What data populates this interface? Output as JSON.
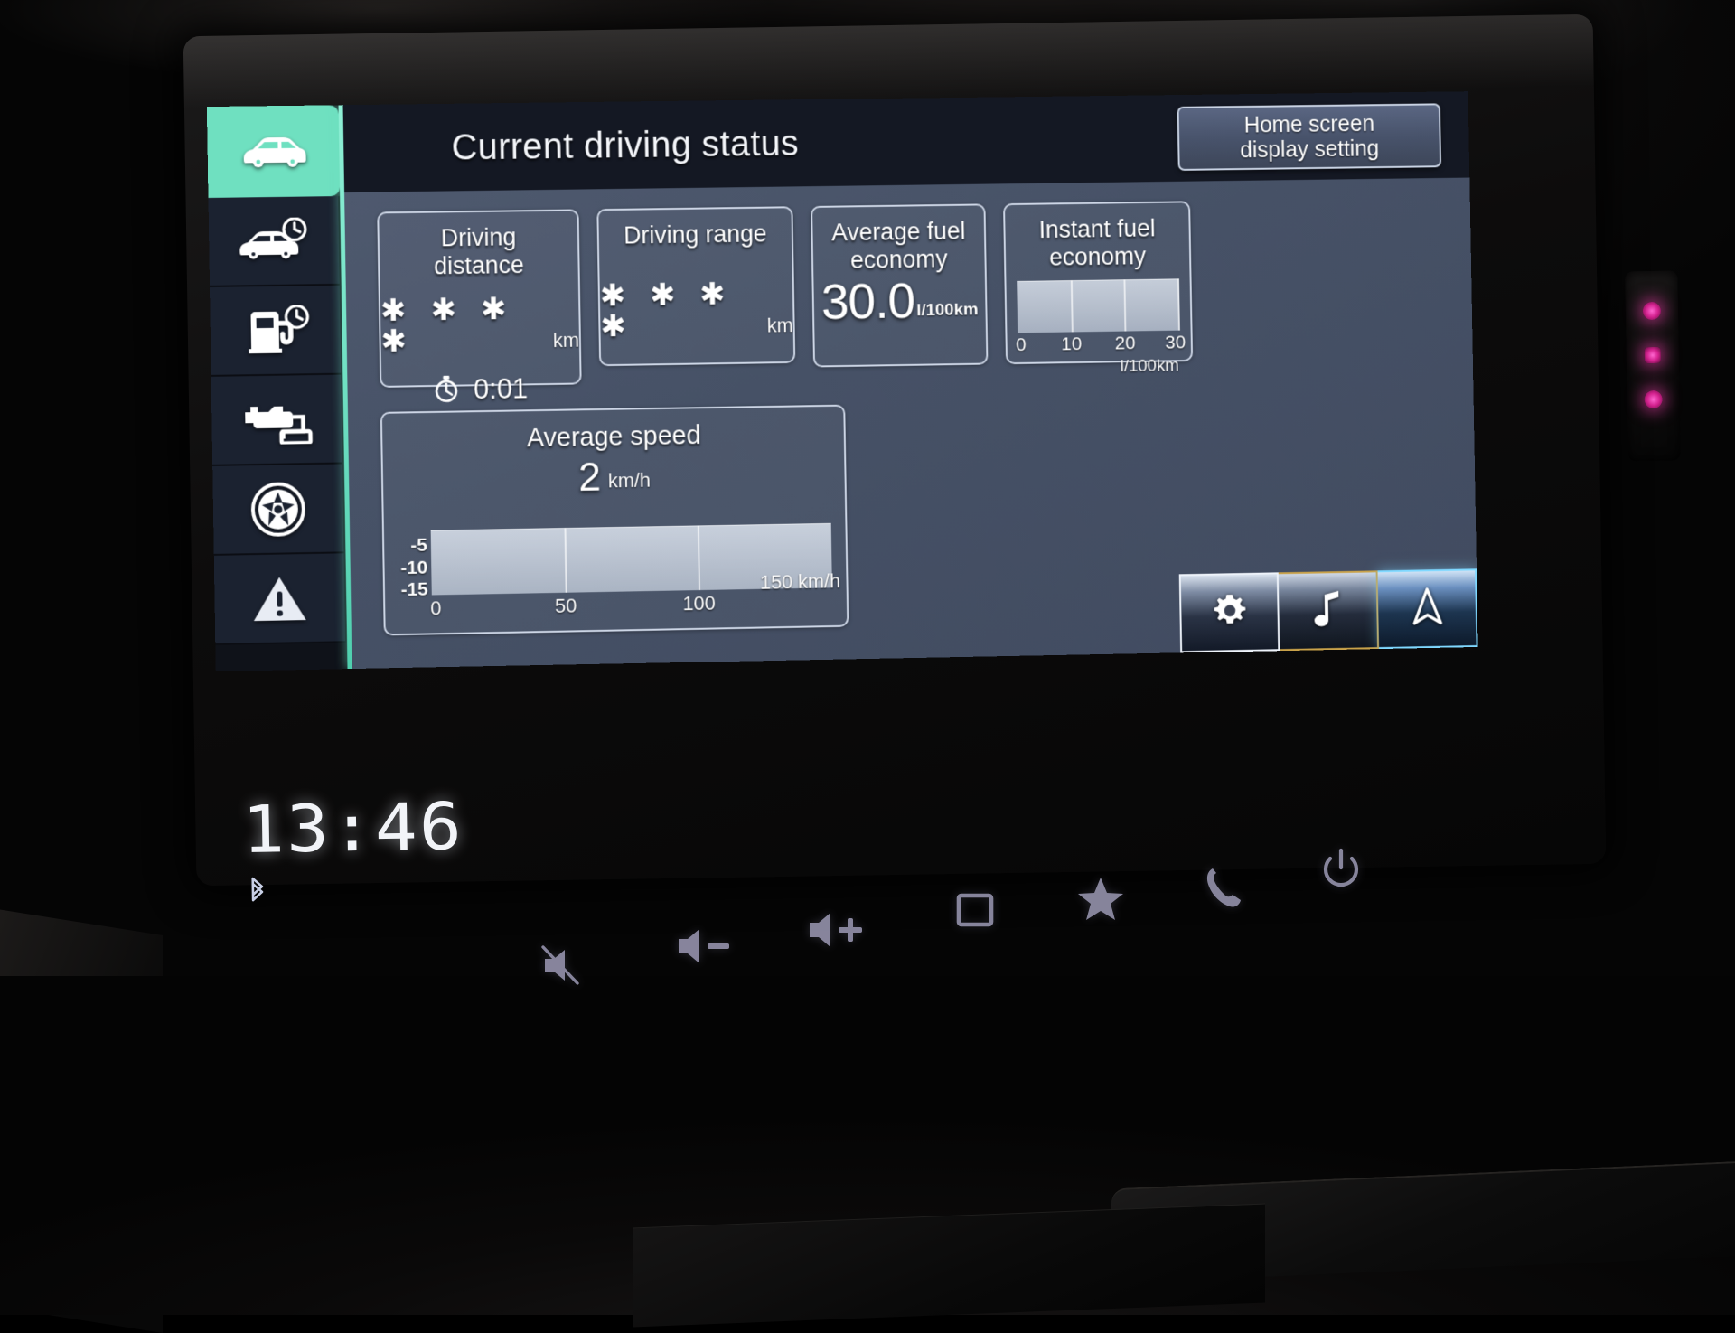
{
  "screen": {
    "header": {
      "title": "Current driving status",
      "home_button": {
        "line1": "Home screen",
        "line2": "display setting"
      }
    },
    "sidebar": {
      "items": [
        {
          "name": "vehicle-status",
          "icon": "car-icon",
          "active": true
        },
        {
          "name": "trip-info",
          "icon": "car-clock-icon",
          "active": false
        },
        {
          "name": "fuel-history",
          "icon": "fuel-pump-clock-icon",
          "active": false
        },
        {
          "name": "energy-flow",
          "icon": "engine-battery-icon",
          "active": false
        },
        {
          "name": "tyre-pressure",
          "icon": "wheel-icon",
          "active": false
        },
        {
          "name": "warnings",
          "icon": "warning-triangle-icon",
          "active": false
        }
      ]
    },
    "cards": {
      "driving_distance": {
        "title": "Driving\ndistance",
        "value": "✱ ✱ ✱ ✱",
        "unit": "km",
        "timer_icon": "stopwatch-icon",
        "timer_value": "0:01"
      },
      "driving_range": {
        "title": "Driving range",
        "value": "✱ ✱ ✱ ✱",
        "unit": "km"
      },
      "average_fuel_economy": {
        "title": "Average fuel\neconomy",
        "value": "30.0",
        "unit": "l/100km"
      },
      "instant_fuel_economy": {
        "title": "Instant fuel\neconomy",
        "unit": "l/100km"
      },
      "average_speed": {
        "title": "Average speed",
        "value": "2",
        "unit": "km/h"
      }
    },
    "launcher": {
      "buttons": [
        {
          "name": "settings",
          "icon": "gear-icon",
          "accent": "#eef3fa"
        },
        {
          "name": "media",
          "icon": "music-note-icon",
          "accent": "#c9a24a"
        },
        {
          "name": "navigation",
          "icon": "navigation-arrow-icon",
          "accent": "#7fd8ff"
        }
      ]
    },
    "colors": {
      "active_tab": "#6fe0c0",
      "panel_bg": "#46516a",
      "topbar_bg": "#141823",
      "card_border": "#cdd6e6",
      "gauge_fill": "#b8c1cf"
    }
  },
  "chart_data": [
    {
      "type": "bar",
      "name": "instant-fuel-economy-gauge",
      "title": "Instant fuel economy",
      "xlabel": "l/100km",
      "ylabel": "",
      "tick_labels": [
        "0",
        "10",
        "20",
        "30"
      ],
      "tick_values": [
        0,
        10,
        20,
        30
      ],
      "xlim": [
        0,
        30
      ],
      "values": [
        30
      ],
      "grid": true,
      "legend": "none"
    },
    {
      "type": "bar",
      "name": "average-speed-gauge",
      "title": "Average speed",
      "xlabel": "km/h",
      "ylabel": "",
      "tick_labels": [
        "0",
        "50",
        "100",
        "150 km/h"
      ],
      "tick_values": [
        0,
        50,
        100,
        150
      ],
      "xlim": [
        0,
        150
      ],
      "y_tick_labels": [
        "-5",
        "-10",
        "-15"
      ],
      "values": [
        150
      ],
      "grid": true,
      "legend": "none"
    }
  ],
  "below_screen": {
    "clock": "13:46",
    "bluetooth_icon": "bluetooth-icon"
  },
  "hardware_buttons": [
    {
      "name": "mute",
      "icon": "mute-icon"
    },
    {
      "name": "volume-down",
      "icon": "volume-down-icon"
    },
    {
      "name": "volume-up",
      "icon": "volume-up-icon"
    },
    {
      "name": "screen-off",
      "icon": "square-icon"
    },
    {
      "name": "favourite",
      "icon": "star-icon"
    },
    {
      "name": "phone",
      "icon": "phone-icon"
    },
    {
      "name": "power",
      "icon": "power-icon"
    }
  ],
  "indicator_leds": [
    {
      "name": "led-top",
      "color": "#ec3caa",
      "shape": "round"
    },
    {
      "name": "led-middle",
      "color": "#ec3caa",
      "shape": "square"
    },
    {
      "name": "led-bottom",
      "color": "#ec3caa",
      "shape": "round"
    }
  ]
}
